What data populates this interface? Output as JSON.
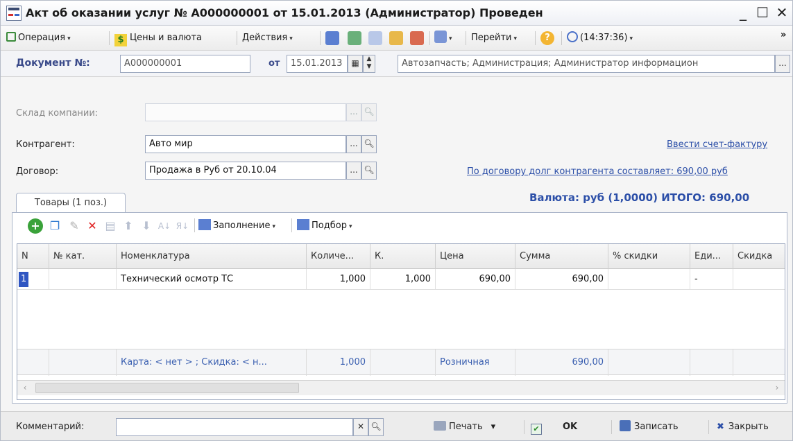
{
  "window": {
    "title": "Акт об оказании услуг № А000000001 от 15.01.2013 (Администратор) Проведен",
    "minimize": "_",
    "maximize": "☐",
    "close": "✕"
  },
  "toolbar": {
    "operation": "Операция",
    "prices": "Цены и валюта",
    "actions": "Действия",
    "goto": "Перейти",
    "help": "?",
    "time": "(14:37:36)",
    "more": "»",
    "caret": "▾"
  },
  "doc": {
    "number_label": "Документ №:",
    "number_value": "А000000001",
    "date_label": "от",
    "date_value": "15.01.2013",
    "organization_value": "Автозапчасть; Администрация; Администратор информацион"
  },
  "form": {
    "warehouse_label": "Склад компании:",
    "warehouse_value": "",
    "contractor_label": "Контрагент:",
    "contractor_value": "Авто мир",
    "contract_label": "Договор:",
    "contract_value": "Продажа в Руб от 20.10.04",
    "invoice_link": "Ввести счет-фактуру",
    "debt_link": "По договору долг контрагента составляет: 690,00 руб",
    "currency_total": "Валюта: руб (1,0000) ИТОГО: 690,00"
  },
  "tabs": {
    "goods": "Товары (1 поз.)"
  },
  "table_toolbar": {
    "fill": "Заполнение",
    "select": "Подбор"
  },
  "table": {
    "columns": [
      "N",
      "№ кат.",
      "Номенклатура",
      "Количе...",
      "К.",
      "Цена",
      "Сумма",
      "% скидки",
      "Еди...",
      "Скидка"
    ],
    "rows": [
      [
        "1",
        "",
        "Технический осмотр ТС",
        "1,000",
        "1,000",
        "690,00",
        "690,00",
        "",
        "-",
        ""
      ]
    ],
    "footer": {
      "card": "Карта: < нет > ; Скидка: < н...",
      "qty": "1,000",
      "price_type": "Розничная",
      "sum": "690,00"
    }
  },
  "bottom": {
    "comment_label": "Комментарий:",
    "comment_value": "",
    "print": "Печать",
    "ok": "OK",
    "save": "Записать",
    "close": "Закрыть"
  },
  "colors": {
    "accent": "#2c4fa8",
    "selected_cell": "#2f56c2",
    "label_blue": "#3a4a8a"
  }
}
